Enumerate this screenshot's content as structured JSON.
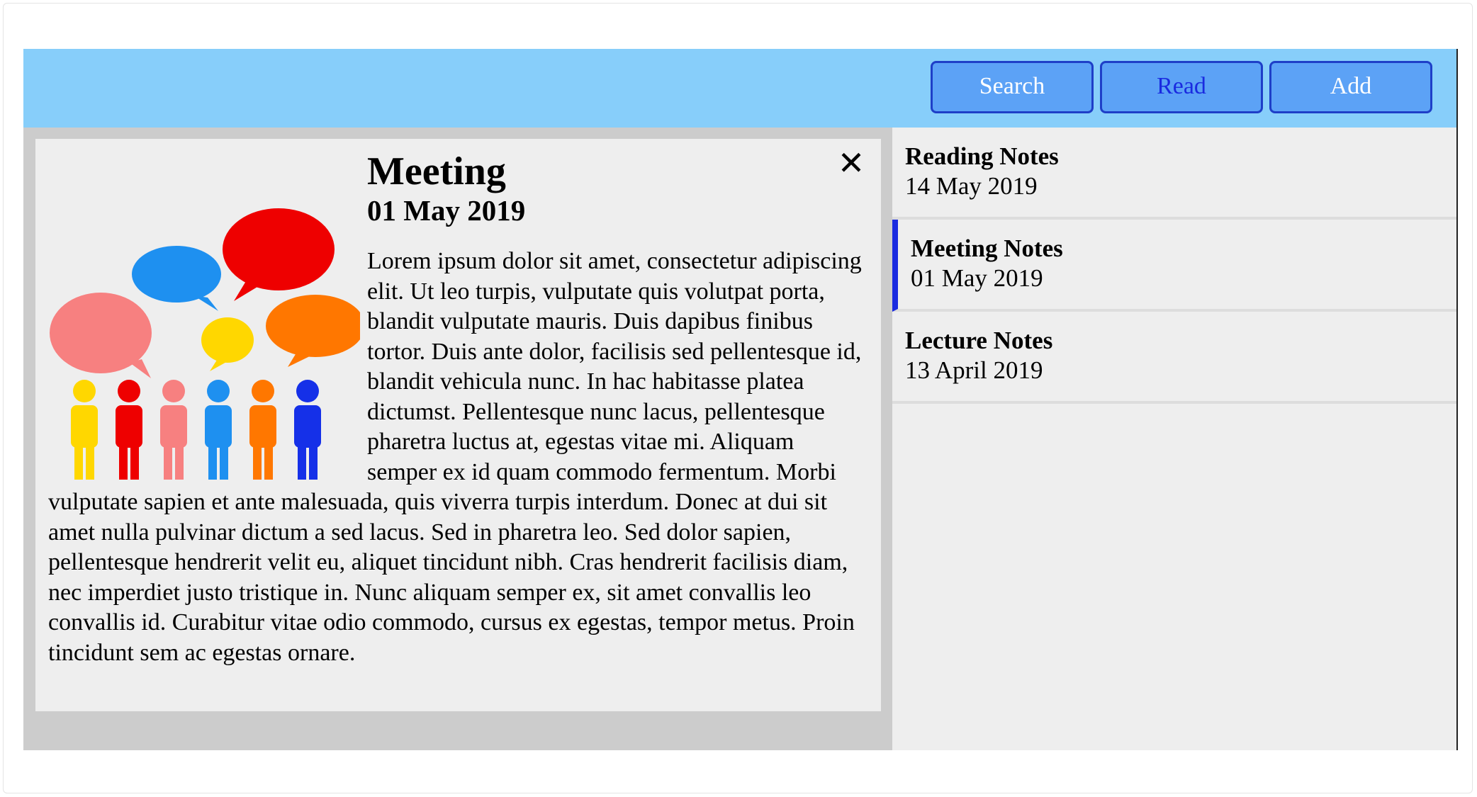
{
  "toolbar": {
    "search_label": "Search",
    "read_label": "Read",
    "add_label": "Add"
  },
  "note": {
    "title": "Meeting",
    "date": "01 May 2019",
    "body": "Lorem ipsum dolor sit amet, consectetur adipiscing elit. Ut leo turpis, vulputate quis volutpat porta, blandit vulputate mauris. Duis dapibus finibus tortor. Duis ante dolor, facilisis sed pellentesque id, blandit vehicula nunc. In hac habitasse platea dictumst. Pellentesque nunc lacus, pellentesque pharetra luctus at, egestas vitae mi. Aliquam semper ex id quam commodo fermentum. Morbi vulputate sapien et ante malesuada, quis viverra turpis interdum. Donec at dui sit amet nulla pulvinar dictum a sed lacus. Sed in pharetra leo. Sed dolor sapien, pellentesque hendrerit velit eu, aliquet tincidunt nibh. Cras hendrerit facilisis diam, nec imperdiet justo tristique in. Nunc aliquam semper ex, sit amet convallis leo convallis id. Curabitur vitae odio commodo, cursus ex egestas, tempor metus. Proin tincidunt sem ac egestas ornare.",
    "close_icon": "close-icon",
    "illustration_icon": "people-talking-icon"
  },
  "sidebar": {
    "items": [
      {
        "title": "Reading Notes",
        "date": "14 May 2019",
        "selected": false
      },
      {
        "title": "Meeting Notes",
        "date": "01 May 2019",
        "selected": true
      },
      {
        "title": "Lecture Notes",
        "date": "13 April 2019",
        "selected": false
      }
    ]
  },
  "colors": {
    "topbar": "#87cefa",
    "button_fill": "#5ca2f6",
    "button_border": "#1e3fc8",
    "selected_accent": "#1a2be0",
    "panel_bg": "#eeeeee",
    "frame_bg": "#cccccc"
  }
}
